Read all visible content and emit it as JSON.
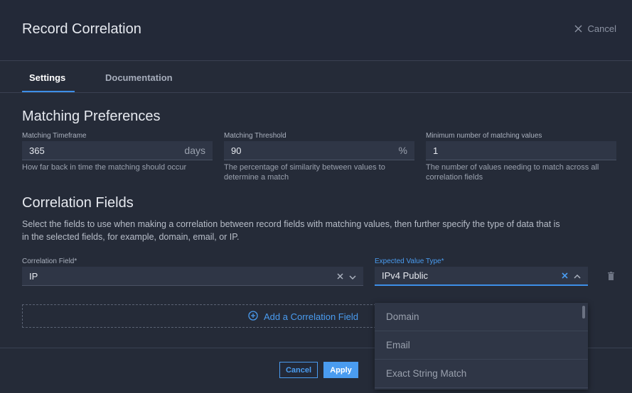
{
  "header": {
    "title": "Record Correlation",
    "close_label": "Cancel"
  },
  "tabs": [
    {
      "label": "Settings",
      "active": true
    },
    {
      "label": "Documentation",
      "active": false
    }
  ],
  "matching": {
    "title": "Matching Preferences",
    "timeframe": {
      "label": "Matching Timeframe",
      "value": "365",
      "suffix": "days",
      "help": "How far back in time the matching should occur"
    },
    "threshold": {
      "label": "Matching Threshold",
      "value": "90",
      "suffix": "%",
      "help_line1": "The percentage of similarity between values to",
      "help_line2": "determine a match"
    },
    "min_values": {
      "label": "Minimum number of matching values",
      "value": "1",
      "help_line1": "The number of values needing to match across all",
      "help_line2": "correlation fields"
    }
  },
  "correlation": {
    "title": "Correlation Fields",
    "desc_line1": "Select the fields to use when making a correlation between record fields with matching values, then further specify the type of data that is",
    "desc_line2": "in the selected fields, for example, domain, email, or IP.",
    "field": {
      "label": "Correlation Field*",
      "value": "IP"
    },
    "value_type": {
      "label": "Expected Value Type*",
      "value": "IPv4 Public"
    },
    "add_label": "Add a Correlation Field"
  },
  "dropdown": {
    "options": [
      "Domain",
      "Email",
      "Exact String Match"
    ]
  },
  "footer": {
    "cancel_label": "Cancel",
    "apply_label": "Apply"
  },
  "colors": {
    "accent": "#4a9cf0",
    "background": "#252b38",
    "input": "#2f3646"
  }
}
